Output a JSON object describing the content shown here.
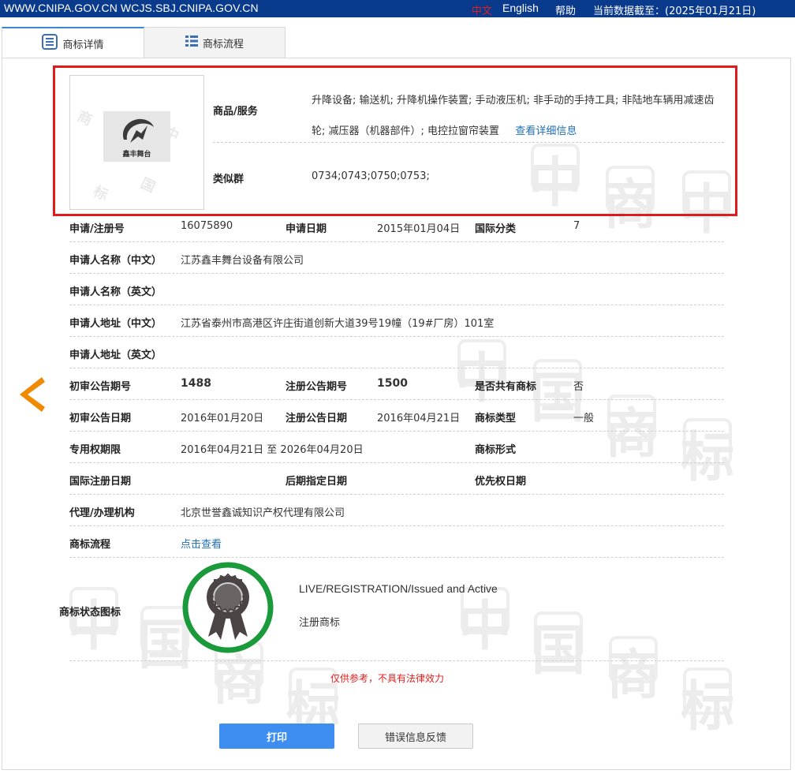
{
  "topbar": {
    "domain": "WWW.CNIPA.GOV.CN WCJS.SBJ.CNIPA.GOV.CN",
    "lang_zh": "中文",
    "lang_en": "English",
    "help": "帮助",
    "data_date": "当前数据截至：(2025年01月21日)"
  },
  "tabs": [
    {
      "label": "商标详情",
      "icon": "document-list-icon",
      "active": true
    },
    {
      "label": "商标流程",
      "icon": "list-icon",
      "active": false
    }
  ],
  "logo": {
    "text": "鑫丰舞台"
  },
  "goods": {
    "label": "商品/服务",
    "text": "升降设备; 输送机; 升降机操作装置; 手动液压机; 非手动的手持工具; 非陆地车辆用减速齿轮; 减压器（机器部件）; 电控拉窗帘装置",
    "more_link": "查看详细信息"
  },
  "similar_group": {
    "label": "类似群",
    "value": "0734;0743;0750;0753;"
  },
  "fields": {
    "reg_no_label": "申请/注册号",
    "reg_no": "16075890",
    "app_date_label": "申请日期",
    "app_date": "2015年01月04日",
    "intl_class_label": "国际分类",
    "intl_class": "7",
    "applicant_cn_label": "申请人名称（中文）",
    "applicant_cn": "江苏鑫丰舞台设备有限公司",
    "applicant_en_label": "申请人名称（英文）",
    "applicant_en": "",
    "address_cn_label": "申请人地址（中文）",
    "address_cn": "江苏省泰州市高港区许庄街道创新大道39号19幢（19#厂房）101室",
    "address_en_label": "申请人地址（英文）",
    "address_en": "",
    "prelim_pub_no_label": "初审公告期号",
    "prelim_pub_no": "1488",
    "reg_pub_no_label": "注册公告期号",
    "reg_pub_no": "1500",
    "shared_label": "是否共有商标",
    "shared": "否",
    "prelim_pub_date_label": "初审公告日期",
    "prelim_pub_date": "2016年01月20日",
    "reg_pub_date_label": "注册公告日期",
    "reg_pub_date": "2016年04月21日",
    "tm_type_label": "商标类型",
    "tm_type": "一般",
    "exclusive_period_label": "专用权期限",
    "exclusive_period": "2016年04月21日 至 2026年04月20日",
    "tm_form_label": "商标形式",
    "tm_form": "",
    "intl_reg_date_label": "国际注册日期",
    "intl_reg_date": "",
    "later_designation_label": "后期指定日期",
    "later_designation": "",
    "priority_date_label": "优先权日期",
    "priority_date": "",
    "agent_label": "代理/办理机构",
    "agent": "北京世誉鑫诚知识产权代理有限公司",
    "process_label": "商标流程",
    "process_link": "点击查看",
    "status_icon_label": "商标状态图标"
  },
  "status": {
    "en": "LIVE/REGISTRATION/Issued and Active",
    "cn": "注册商标",
    "ring_color": "#1a9a3a"
  },
  "watermark": {
    "chars": [
      "中",
      "国",
      "商",
      "标"
    ]
  },
  "disclaimer": "仅供参考，不具有法律效力",
  "buttons": {
    "print": "打印",
    "feedback": "错误信息反馈"
  },
  "colors": {
    "topbar_bg": "#0a3a8c",
    "highlight": "#e01b1b",
    "link": "#1f6fb8",
    "print_button": "#3d8ef0",
    "arrow": "#f08a00"
  }
}
